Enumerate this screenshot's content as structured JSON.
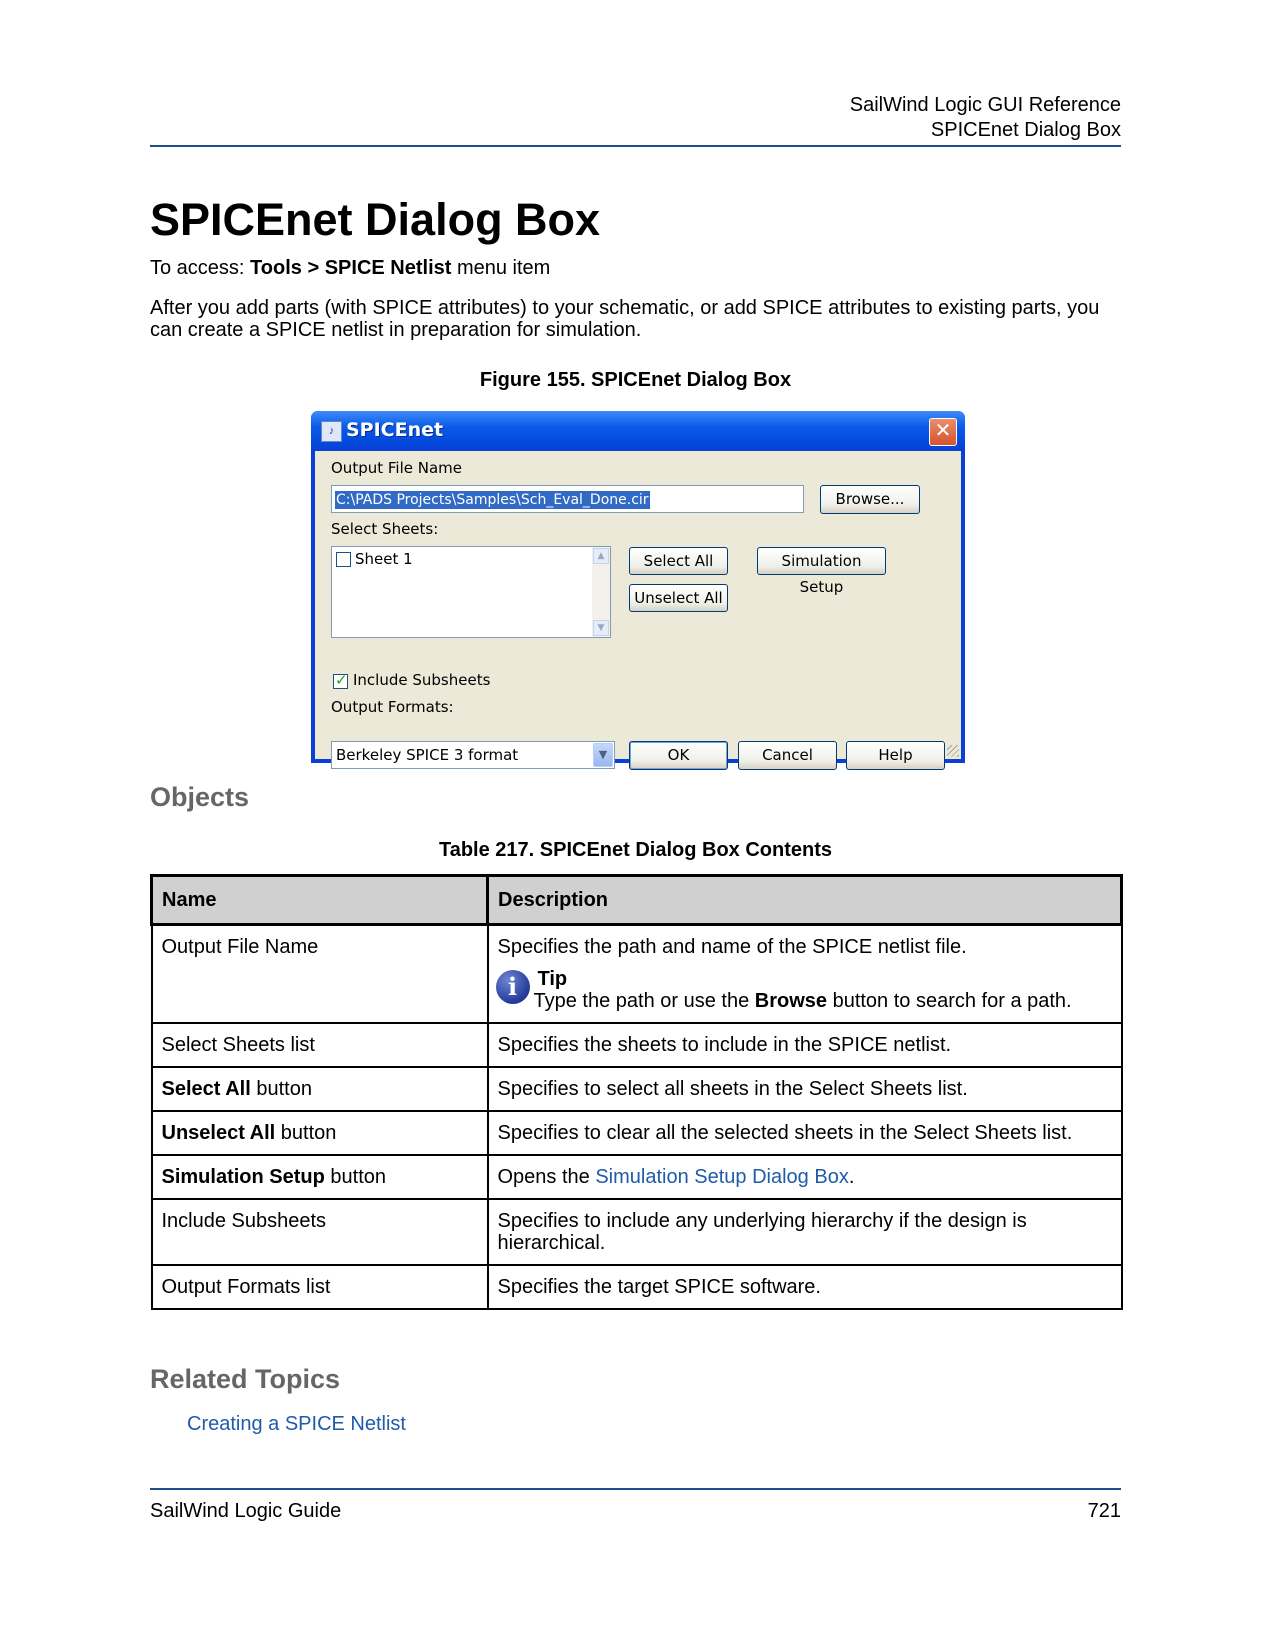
{
  "header": {
    "line1": "SailWind Logic GUI Reference",
    "line2": "SPICEnet Dialog Box"
  },
  "title": "SPICEnet Dialog Box",
  "access": {
    "prefix": "To access: ",
    "menu1": "Tools",
    "sep": " > ",
    "menu2": "SPICE Netlist",
    "suffix": " menu item"
  },
  "intro": "After you add parts (with SPICE attributes) to your schematic, or add SPICE attributes to existing parts, you can create a SPICE netlist in preparation for simulation.",
  "figure_caption": "Figure 155. SPICEnet Dialog Box",
  "dialog": {
    "title": "SPICEnet",
    "close_glyph": "✕",
    "output_file_label": "Output File Name",
    "output_file_value": "C:\\PADS Projects\\Samples\\Sch_Eval_Done.cir",
    "browse_label": "Browse...",
    "select_sheets_label": "Select Sheets:",
    "sheets": [
      "Sheet 1"
    ],
    "select_all_label": "Select All",
    "unselect_all_label": "Unselect All",
    "simulation_setup_label": "Simulation Setup",
    "include_subsheets_label": "Include Subsheets",
    "include_subsheets_checked": true,
    "output_formats_label": "Output Formats:",
    "output_format_value": "Berkeley SPICE 3 format",
    "ok_label": "OK",
    "cancel_label": "Cancel",
    "help_label": "Help"
  },
  "objects_heading": "Objects",
  "table_caption": "Table 217. SPICEnet Dialog Box Contents",
  "table": {
    "headers": [
      "Name",
      "Description"
    ],
    "rows": [
      {
        "name": "Output File Name",
        "desc": "Specifies the path and name of the SPICE netlist file."
      },
      {
        "name": "Select Sheets list",
        "desc": "Specifies the sheets to include in the SPICE netlist."
      },
      {
        "name_bold": "Select All",
        "name_rest": " button",
        "desc": "Specifies to select all sheets in the Select Sheets list."
      },
      {
        "name_bold": "Unselect All",
        "name_rest": " button",
        "desc": "Specifies to clear all the selected sheets in the Select Sheets list."
      },
      {
        "name_bold": "Simulation Setup",
        "name_rest": " button",
        "desc_prefix": "Opens the ",
        "desc_link": "Simulation Setup Dialog Box",
        "desc_suffix": "."
      },
      {
        "name": "Include Subsheets",
        "desc": "Specifies to include any underlying hierarchy if the design is hierarchical."
      },
      {
        "name": "Output Formats list",
        "desc": "Specifies the target SPICE software."
      }
    ],
    "tip": {
      "icon": "info-icon",
      "icon_glyph": "i",
      "title": "Tip",
      "prefix": "Type the path or use the ",
      "bold": "Browse",
      "suffix": " button to search for a path."
    }
  },
  "related_heading": "Related Topics",
  "related_links": [
    "Creating a SPICE Netlist"
  ],
  "footer": {
    "left": "SailWind Logic Guide",
    "page": "721"
  },
  "colors": {
    "rule": "#1f4e8c",
    "heading_gray": "#666666",
    "link": "#1f5ba8",
    "xp_title": "#0a3fd8",
    "dialog_face": "#ece9d8",
    "table_header": "#d0d0d0"
  }
}
